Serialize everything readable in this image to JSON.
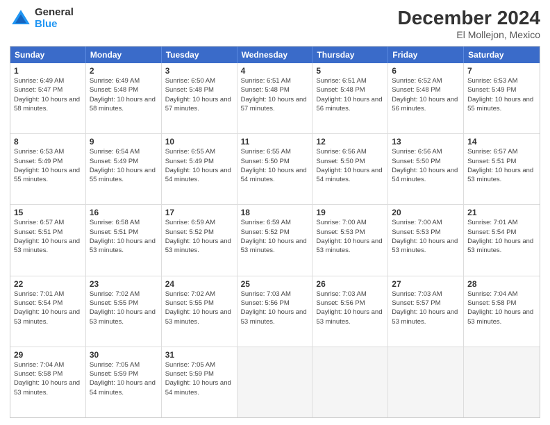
{
  "logo": {
    "general": "General",
    "blue": "Blue"
  },
  "title": {
    "month": "December 2024",
    "location": "El Mollejon, Mexico"
  },
  "header": {
    "days": [
      "Sunday",
      "Monday",
      "Tuesday",
      "Wednesday",
      "Thursday",
      "Friday",
      "Saturday"
    ]
  },
  "weeks": [
    [
      {
        "day": "1",
        "sunrise": "6:49 AM",
        "sunset": "5:47 PM",
        "daylight": "10 hours and 58 minutes."
      },
      {
        "day": "2",
        "sunrise": "6:49 AM",
        "sunset": "5:48 PM",
        "daylight": "10 hours and 58 minutes."
      },
      {
        "day": "3",
        "sunrise": "6:50 AM",
        "sunset": "5:48 PM",
        "daylight": "10 hours and 57 minutes."
      },
      {
        "day": "4",
        "sunrise": "6:51 AM",
        "sunset": "5:48 PM",
        "daylight": "10 hours and 57 minutes."
      },
      {
        "day": "5",
        "sunrise": "6:51 AM",
        "sunset": "5:48 PM",
        "daylight": "10 hours and 56 minutes."
      },
      {
        "day": "6",
        "sunrise": "6:52 AM",
        "sunset": "5:48 PM",
        "daylight": "10 hours and 56 minutes."
      },
      {
        "day": "7",
        "sunrise": "6:53 AM",
        "sunset": "5:49 PM",
        "daylight": "10 hours and 55 minutes."
      }
    ],
    [
      {
        "day": "8",
        "sunrise": "6:53 AM",
        "sunset": "5:49 PM",
        "daylight": "10 hours and 55 minutes."
      },
      {
        "day": "9",
        "sunrise": "6:54 AM",
        "sunset": "5:49 PM",
        "daylight": "10 hours and 55 minutes."
      },
      {
        "day": "10",
        "sunrise": "6:55 AM",
        "sunset": "5:49 PM",
        "daylight": "10 hours and 54 minutes."
      },
      {
        "day": "11",
        "sunrise": "6:55 AM",
        "sunset": "5:50 PM",
        "daylight": "10 hours and 54 minutes."
      },
      {
        "day": "12",
        "sunrise": "6:56 AM",
        "sunset": "5:50 PM",
        "daylight": "10 hours and 54 minutes."
      },
      {
        "day": "13",
        "sunrise": "6:56 AM",
        "sunset": "5:50 PM",
        "daylight": "10 hours and 54 minutes."
      },
      {
        "day": "14",
        "sunrise": "6:57 AM",
        "sunset": "5:51 PM",
        "daylight": "10 hours and 53 minutes."
      }
    ],
    [
      {
        "day": "15",
        "sunrise": "6:57 AM",
        "sunset": "5:51 PM",
        "daylight": "10 hours and 53 minutes."
      },
      {
        "day": "16",
        "sunrise": "6:58 AM",
        "sunset": "5:51 PM",
        "daylight": "10 hours and 53 minutes."
      },
      {
        "day": "17",
        "sunrise": "6:59 AM",
        "sunset": "5:52 PM",
        "daylight": "10 hours and 53 minutes."
      },
      {
        "day": "18",
        "sunrise": "6:59 AM",
        "sunset": "5:52 PM",
        "daylight": "10 hours and 53 minutes."
      },
      {
        "day": "19",
        "sunrise": "7:00 AM",
        "sunset": "5:53 PM",
        "daylight": "10 hours and 53 minutes."
      },
      {
        "day": "20",
        "sunrise": "7:00 AM",
        "sunset": "5:53 PM",
        "daylight": "10 hours and 53 minutes."
      },
      {
        "day": "21",
        "sunrise": "7:01 AM",
        "sunset": "5:54 PM",
        "daylight": "10 hours and 53 minutes."
      }
    ],
    [
      {
        "day": "22",
        "sunrise": "7:01 AM",
        "sunset": "5:54 PM",
        "daylight": "10 hours and 53 minutes."
      },
      {
        "day": "23",
        "sunrise": "7:02 AM",
        "sunset": "5:55 PM",
        "daylight": "10 hours and 53 minutes."
      },
      {
        "day": "24",
        "sunrise": "7:02 AM",
        "sunset": "5:55 PM",
        "daylight": "10 hours and 53 minutes."
      },
      {
        "day": "25",
        "sunrise": "7:03 AM",
        "sunset": "5:56 PM",
        "daylight": "10 hours and 53 minutes."
      },
      {
        "day": "26",
        "sunrise": "7:03 AM",
        "sunset": "5:56 PM",
        "daylight": "10 hours and 53 minutes."
      },
      {
        "day": "27",
        "sunrise": "7:03 AM",
        "sunset": "5:57 PM",
        "daylight": "10 hours and 53 minutes."
      },
      {
        "day": "28",
        "sunrise": "7:04 AM",
        "sunset": "5:58 PM",
        "daylight": "10 hours and 53 minutes."
      }
    ],
    [
      {
        "day": "29",
        "sunrise": "7:04 AM",
        "sunset": "5:58 PM",
        "daylight": "10 hours and 53 minutes."
      },
      {
        "day": "30",
        "sunrise": "7:05 AM",
        "sunset": "5:59 PM",
        "daylight": "10 hours and 54 minutes."
      },
      {
        "day": "31",
        "sunrise": "7:05 AM",
        "sunset": "5:59 PM",
        "daylight": "10 hours and 54 minutes."
      },
      null,
      null,
      null,
      null
    ]
  ]
}
